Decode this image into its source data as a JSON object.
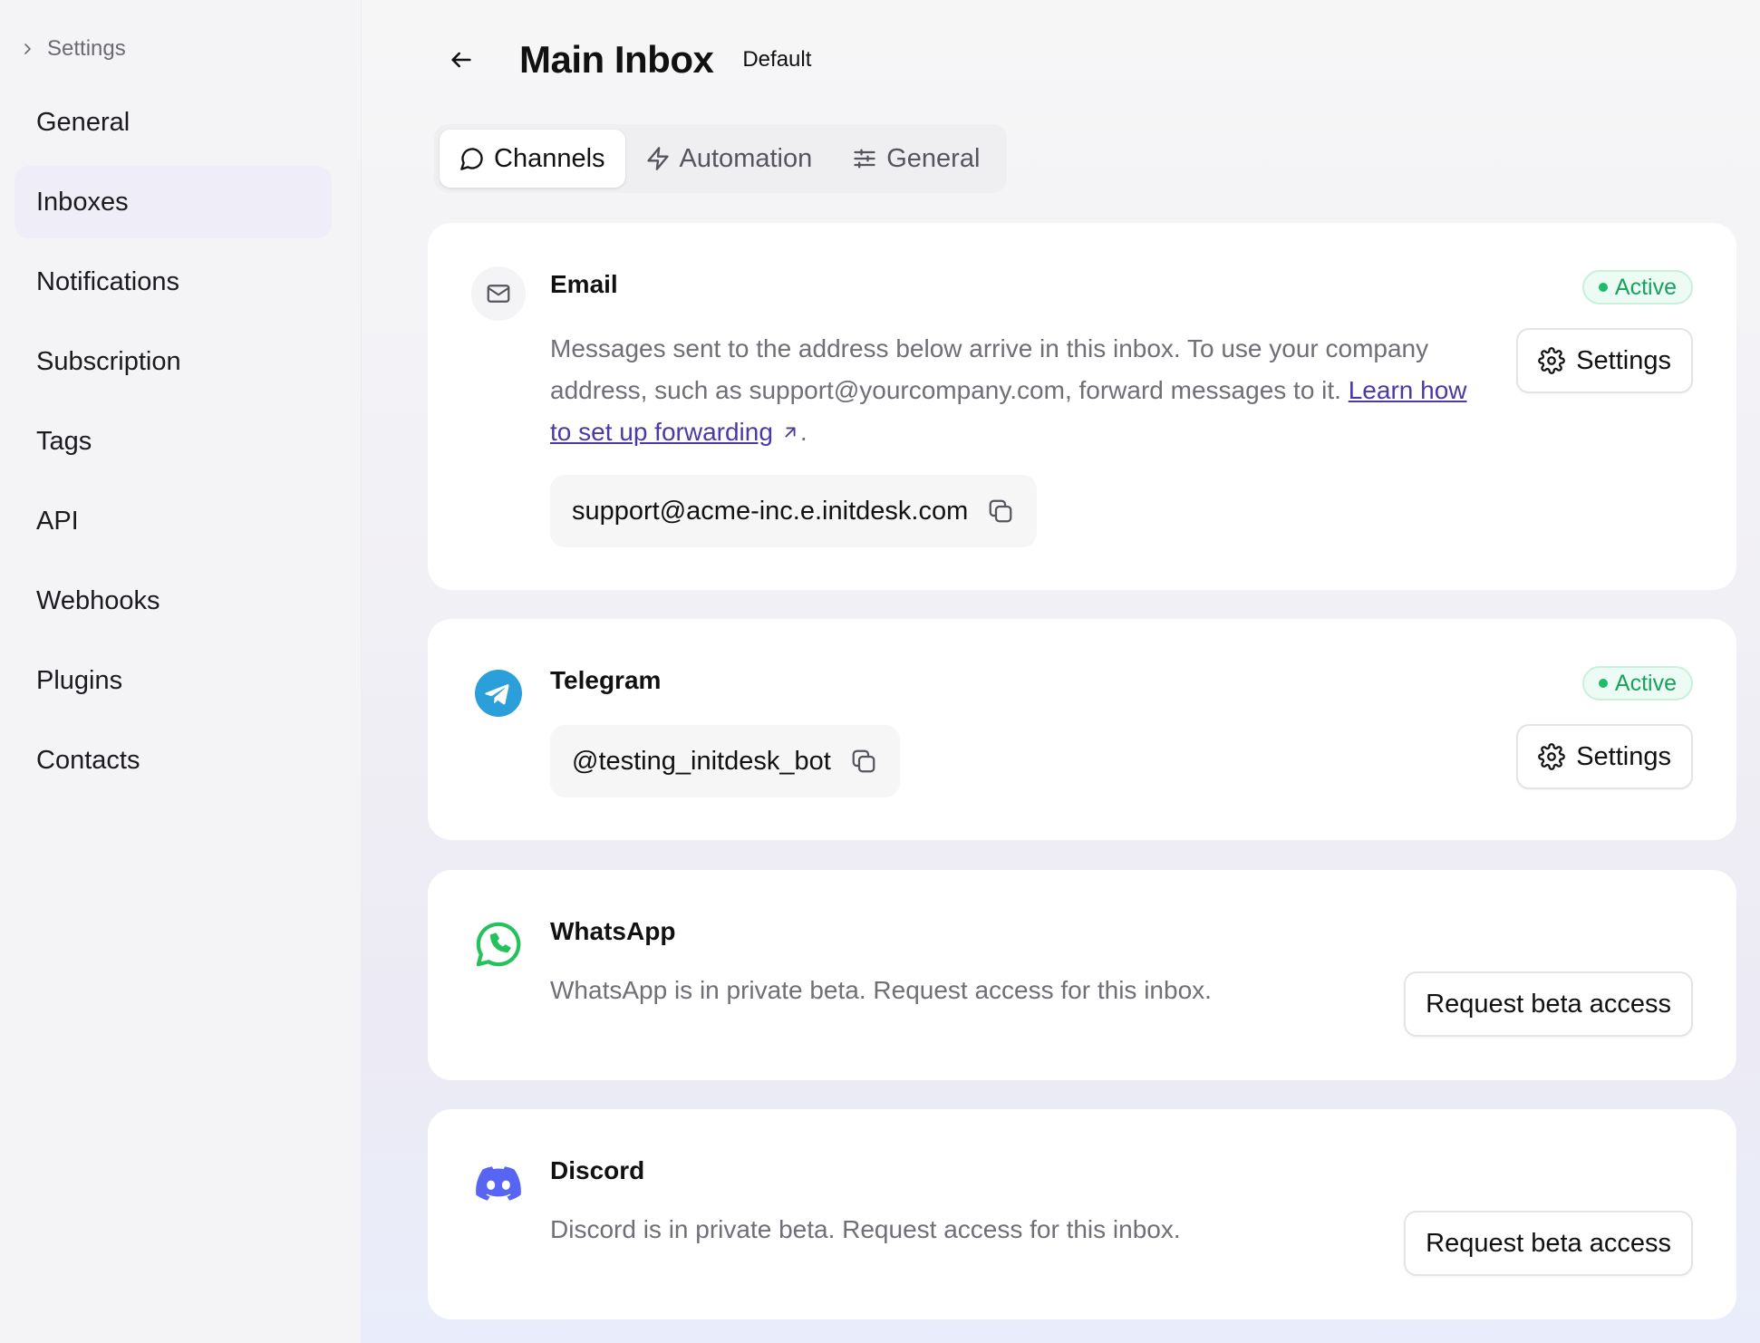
{
  "sidebar": {
    "breadcrumb": "Settings",
    "items": [
      {
        "label": "General"
      },
      {
        "label": "Inboxes",
        "active": true
      },
      {
        "label": "Notifications"
      },
      {
        "label": "Subscription"
      },
      {
        "label": "Tags"
      },
      {
        "label": "API"
      },
      {
        "label": "Webhooks"
      },
      {
        "label": "Plugins"
      },
      {
        "label": "Contacts"
      }
    ]
  },
  "header": {
    "title": "Main Inbox",
    "tag": "Default"
  },
  "tabs": [
    {
      "label": "Channels",
      "icon": "message-circle-icon",
      "active": true
    },
    {
      "label": "Automation",
      "icon": "lightning-icon"
    },
    {
      "label": "General",
      "icon": "sliders-icon"
    }
  ],
  "channels": {
    "email": {
      "name": "Email",
      "status": "Active",
      "desc_part1": "Messages sent to the address below arrive in this inbox. To use your company address, such as support@yourcompany.com, forward messages to it. ",
      "link_text": "Learn how to set up forwarding",
      "desc_part2": ".",
      "address": "support@acme-inc.e.initdesk.com",
      "settings_label": "Settings"
    },
    "telegram": {
      "name": "Telegram",
      "status": "Active",
      "handle": "@testing_initdesk_bot",
      "settings_label": "Settings"
    },
    "whatsapp": {
      "name": "WhatsApp",
      "desc": "WhatsApp is in private beta. Request access for this inbox.",
      "button_label": "Request beta access"
    },
    "discord": {
      "name": "Discord",
      "desc": "Discord is in private beta. Request access for this inbox.",
      "button_label": "Request beta access"
    }
  },
  "colors": {
    "active_green": "#17a35c",
    "link_purple": "#4a3aa8",
    "telegram_blue": "#2a9fd9",
    "whatsapp_green": "#25c15a",
    "discord_blurple": "#5865f2"
  }
}
